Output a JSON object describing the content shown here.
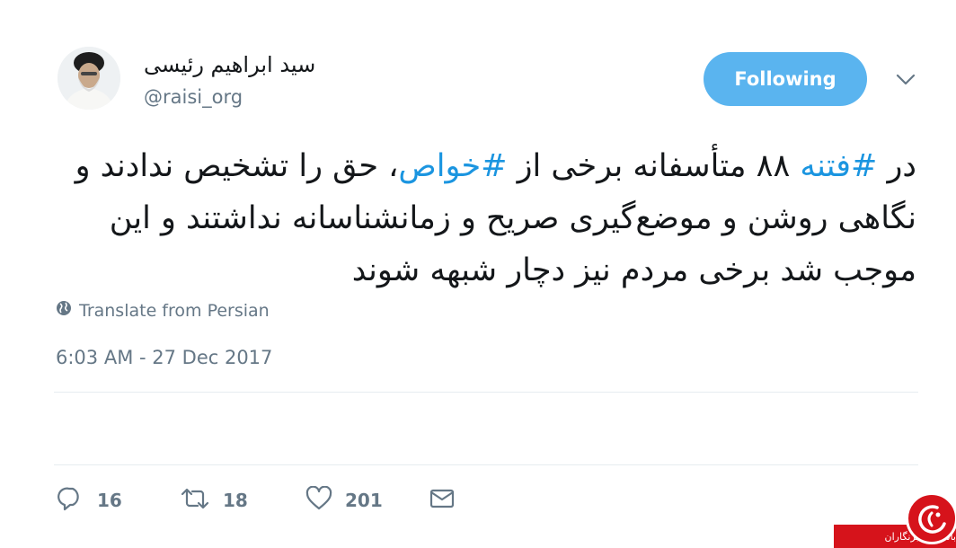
{
  "author": {
    "display_name": "سید ابراهیم رئیسی",
    "handle": "@raisi_org",
    "avatar_icon": "profile-photo"
  },
  "follow_button": {
    "label": "Following",
    "color": "#5ab4ef"
  },
  "caret_icon": "chevron-down-icon",
  "tweet": {
    "seg1": "در ",
    "hashtag1": "#فتنه",
    "seg2": " ۸۸ متأسفانه برخی از ",
    "hashtag2": "#خواص",
    "seg3": "، حق را تشخیص ندادند و نگاهی روشن و موضع‌گیری صریح و زمانشناسانه نداشتند و این موجب شد برخی مردم نیز دچار شبهه شوند",
    "hashtag_color": "#1b95e0"
  },
  "translate": {
    "label": "Translate from Persian",
    "icon": "globe-icon"
  },
  "timestamp": "6:03 AM - 27 Dec 2017",
  "actions": {
    "reply": {
      "icon": "reply-icon",
      "count": "16"
    },
    "retweet": {
      "icon": "retweet-icon",
      "count": "18"
    },
    "like": {
      "icon": "heart-icon",
      "count": "201"
    },
    "dm": {
      "icon": "envelope-icon"
    }
  },
  "watermark": {
    "text": "باشگاه خبرنگاران",
    "color": "#d6131b"
  }
}
